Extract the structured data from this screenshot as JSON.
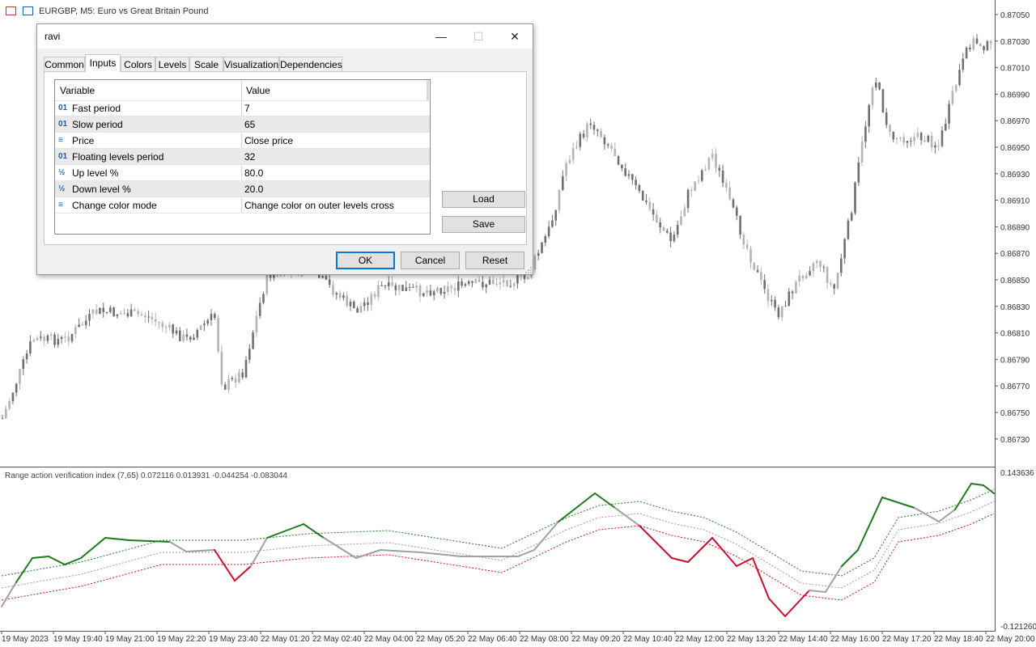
{
  "chart": {
    "symbol_label": "EURGBP, M5:  Euro vs Great Britain Pound",
    "price_axis": [
      "0.87050",
      "0.87030",
      "0.87010",
      "0.86990",
      "0.86970",
      "0.86950",
      "0.86930",
      "0.86910",
      "0.86890",
      "0.86870",
      "0.86850",
      "0.86830",
      "0.86810",
      "0.86790",
      "0.86770",
      "0.86750",
      "0.86730"
    ],
    "time_axis": [
      "19 May 2023",
      "19 May 19:40",
      "19 May 21:00",
      "19 May 22:20",
      "19 May 23:40",
      "22 May 01:20",
      "22 May 02:40",
      "22 May 04:00",
      "22 May 05:20",
      "22 May 06:40",
      "22 May 08:00",
      "22 May 09:20",
      "22 May 10:40",
      "22 May 12:00",
      "22 May 13:20",
      "22 May 14:40",
      "22 May 16:00",
      "22 May 17:20",
      "22 May 18:40",
      "22 May 20:00"
    ],
    "candle_color": "#707070",
    "candle_color_light": "#b4b4b4"
  },
  "indicator": {
    "label": "Range action verification index (7,65) 0.072116 0.013931 -0.044254 -0.083044",
    "axis_top": "0.143636",
    "axis_bottom": "-0.121260",
    "colors": {
      "up": "#1e7a1e",
      "down": "#c8102e",
      "neutral": "#a0a0a0",
      "upper_level": "#1e7a1e",
      "lower_level": "#c8102e",
      "middle_level": "#9a9a9a"
    }
  },
  "dialog": {
    "title": "ravi",
    "tabs": [
      "Common",
      "Inputs",
      "Colors",
      "Levels",
      "Scale",
      "Visualization",
      "Dependencies"
    ],
    "active_tab": "Inputs",
    "table": {
      "headers": {
        "variable": "Variable",
        "value": "Value"
      },
      "rows": [
        {
          "icon": "01",
          "icon_name": "integer-icon",
          "variable": "Fast period",
          "value": "7"
        },
        {
          "icon": "01",
          "icon_name": "integer-icon",
          "variable": "Slow period",
          "value": "65"
        },
        {
          "icon": "≡",
          "icon_name": "enum-icon",
          "variable": "Price",
          "value": "Close price"
        },
        {
          "icon": "01",
          "icon_name": "integer-icon",
          "variable": "Floating levels period",
          "value": "32"
        },
        {
          "icon": "½",
          "icon_name": "double-icon",
          "variable": "Up level %",
          "value": "80.0"
        },
        {
          "icon": "½",
          "icon_name": "double-icon",
          "variable": "Down level %",
          "value": "20.0"
        },
        {
          "icon": "≡",
          "icon_name": "enum-icon",
          "variable": "Change color mode",
          "value": "Change color on outer levels cross"
        }
      ]
    },
    "side_buttons": {
      "load": "Load",
      "save": "Save"
    },
    "buttons": {
      "ok": "OK",
      "cancel": "Cancel",
      "reset": "Reset"
    },
    "window_buttons": {
      "minimize": "—",
      "maximize": "☐",
      "close": "✕"
    }
  }
}
